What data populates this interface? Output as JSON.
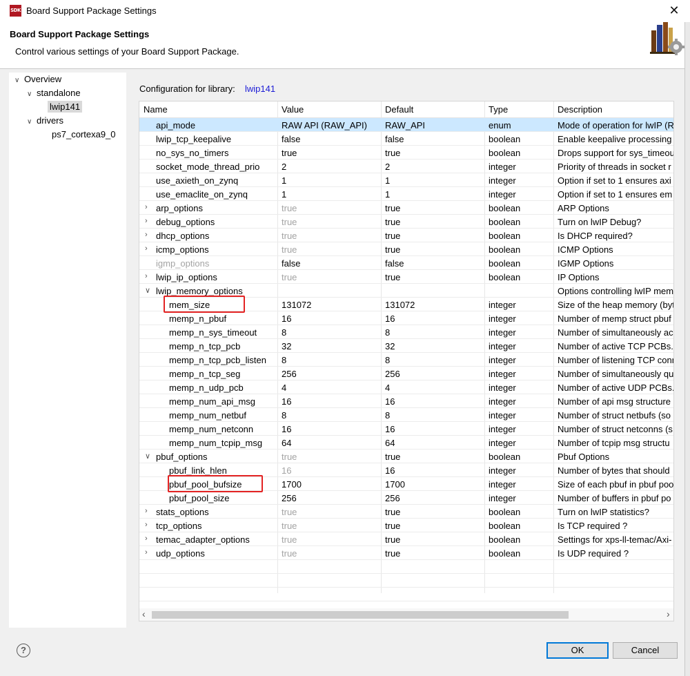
{
  "window": {
    "app_icon_text": "SDK",
    "title": "Board Support Package Settings",
    "close_glyph": "✕"
  },
  "header": {
    "title": "Board Support Package Settings",
    "subtitle": "Control various settings of your Board Support Package.",
    "banner_icon": "books-gear-icon"
  },
  "tree": [
    {
      "label": "Overview",
      "depth": 0,
      "expanded": true,
      "selected": false
    },
    {
      "label": "standalone",
      "depth": 1,
      "expanded": true,
      "selected": false
    },
    {
      "label": "lwip141",
      "depth": 2,
      "expanded": false,
      "selected": true
    },
    {
      "label": "drivers",
      "depth": 1,
      "expanded": true,
      "selected": false
    },
    {
      "label": "ps7_cortexa9_0",
      "depth": 2,
      "expanded": false,
      "selected": false
    }
  ],
  "config": {
    "label": "Configuration for library:",
    "library": "lwip141"
  },
  "table": {
    "columns": [
      "Name",
      "Value",
      "Default",
      "Type",
      "Description"
    ],
    "rows": [
      {
        "indent": 0,
        "expander": "",
        "name": "api_mode",
        "value": "RAW API (RAW_API)",
        "default": "RAW_API",
        "type": "enum",
        "description": "Mode of operation for lwIP (R",
        "selected": true
      },
      {
        "indent": 0,
        "expander": "",
        "name": "lwip_tcp_keepalive",
        "value": "false",
        "default": "false",
        "type": "boolean",
        "description": "Enable keepalive processing"
      },
      {
        "indent": 0,
        "expander": "",
        "name": "no_sys_no_timers",
        "value": "true",
        "default": "true",
        "type": "boolean",
        "description": "Drops support for sys_timeou"
      },
      {
        "indent": 0,
        "expander": "",
        "name": "socket_mode_thread_prio",
        "value": "2",
        "default": "2",
        "type": "integer",
        "description": "Priority of threads in socket r"
      },
      {
        "indent": 0,
        "expander": "",
        "name": "use_axieth_on_zynq",
        "value": "1",
        "default": "1",
        "type": "integer",
        "description": "Option if set to 1 ensures axi"
      },
      {
        "indent": 0,
        "expander": "",
        "name": "use_emaclite_on_zynq",
        "value": "1",
        "default": "1",
        "type": "integer",
        "description": "Option if set to 1 ensures em"
      },
      {
        "indent": 0,
        "expander": ">",
        "name": "arp_options",
        "value": "true",
        "value_dim": true,
        "default": "true",
        "type": "boolean",
        "description": "ARP Options"
      },
      {
        "indent": 0,
        "expander": ">",
        "name": "debug_options",
        "value": "true",
        "value_dim": true,
        "default": "true",
        "type": "boolean",
        "description": "Turn on lwIP Debug?"
      },
      {
        "indent": 0,
        "expander": ">",
        "name": "dhcp_options",
        "value": "true",
        "value_dim": true,
        "default": "true",
        "type": "boolean",
        "description": "Is DHCP required?"
      },
      {
        "indent": 0,
        "expander": ">",
        "name": "icmp_options",
        "value": "true",
        "value_dim": true,
        "default": "true",
        "type": "boolean",
        "description": "ICMP Options"
      },
      {
        "indent": 0,
        "expander": "",
        "name": "igmp_options",
        "name_dim": true,
        "value": "false",
        "default": "false",
        "type": "boolean",
        "description": "IGMP Options"
      },
      {
        "indent": 0,
        "expander": ">",
        "name": "lwip_ip_options",
        "value": "true",
        "value_dim": true,
        "default": "true",
        "type": "boolean",
        "description": "IP Options"
      },
      {
        "indent": 0,
        "expander": "v",
        "name": "lwip_memory_options",
        "value": "",
        "default": "",
        "type": "",
        "description": "Options controlling lwIP mem"
      },
      {
        "indent": 1,
        "expander": "",
        "name": "mem_size",
        "value": "131072",
        "default": "131072",
        "type": "integer",
        "description": "Size of the heap memory (byt"
      },
      {
        "indent": 1,
        "expander": "",
        "name": "memp_n_pbuf",
        "value": "16",
        "default": "16",
        "type": "integer",
        "description": "Number of memp struct pbuf"
      },
      {
        "indent": 1,
        "expander": "",
        "name": "memp_n_sys_timeout",
        "value": "8",
        "default": "8",
        "type": "integer",
        "description": "Number of simultaneously ac"
      },
      {
        "indent": 1,
        "expander": "",
        "name": "memp_n_tcp_pcb",
        "value": "32",
        "default": "32",
        "type": "integer",
        "description": "Number of active TCP PCBs. ("
      },
      {
        "indent": 1,
        "expander": "",
        "name": "memp_n_tcp_pcb_listen",
        "value": "8",
        "default": "8",
        "type": "integer",
        "description": "Number of listening TCP conn"
      },
      {
        "indent": 1,
        "expander": "",
        "name": "memp_n_tcp_seg",
        "value": "256",
        "default": "256",
        "type": "integer",
        "description": "Number of simultaneously qu"
      },
      {
        "indent": 1,
        "expander": "",
        "name": "memp_n_udp_pcb",
        "value": "4",
        "default": "4",
        "type": "integer",
        "description": "Number of active UDP PCBs."
      },
      {
        "indent": 1,
        "expander": "",
        "name": "memp_num_api_msg",
        "value": "16",
        "default": "16",
        "type": "integer",
        "description": "Number of api msg structure"
      },
      {
        "indent": 1,
        "expander": "",
        "name": "memp_num_netbuf",
        "value": "8",
        "default": "8",
        "type": "integer",
        "description": "Number of struct netbufs (so"
      },
      {
        "indent": 1,
        "expander": "",
        "name": "memp_num_netconn",
        "value": "16",
        "default": "16",
        "type": "integer",
        "description": "Number of struct netconns (s"
      },
      {
        "indent": 1,
        "expander": "",
        "name": "memp_num_tcpip_msg",
        "value": "64",
        "default": "64",
        "type": "integer",
        "description": "Number of tcpip msg structu"
      },
      {
        "indent": 0,
        "expander": "v",
        "name": "pbuf_options",
        "value": "true",
        "value_dim": true,
        "default": "true",
        "type": "boolean",
        "description": "Pbuf Options"
      },
      {
        "indent": 1,
        "expander": "",
        "name": "pbuf_link_hlen",
        "value": "16",
        "value_dim": true,
        "default": "16",
        "type": "integer",
        "description": "Number of bytes that should"
      },
      {
        "indent": 1,
        "expander": "",
        "name": "pbuf_pool_bufsize",
        "value": "1700",
        "default": "1700",
        "type": "integer",
        "description": "Size of each pbuf in pbuf poo"
      },
      {
        "indent": 1,
        "expander": "",
        "name": "pbuf_pool_size",
        "value": "256",
        "default": "256",
        "type": "integer",
        "description": "Number of buffers in pbuf po"
      },
      {
        "indent": 0,
        "expander": ">",
        "name": "stats_options",
        "value": "true",
        "value_dim": true,
        "default": "true",
        "type": "boolean",
        "description": "Turn on lwIP statistics?"
      },
      {
        "indent": 0,
        "expander": ">",
        "name": "tcp_options",
        "value": "true",
        "value_dim": true,
        "default": "true",
        "type": "boolean",
        "description": "Is TCP required ?"
      },
      {
        "indent": 0,
        "expander": ">",
        "name": "temac_adapter_options",
        "value": "true",
        "value_dim": true,
        "default": "true",
        "type": "boolean",
        "description": "Settings for xps-ll-temac/Axi-"
      },
      {
        "indent": 0,
        "expander": ">",
        "name": "udp_options",
        "value": "true",
        "value_dim": true,
        "default": "true",
        "type": "boolean",
        "description": "Is UDP required ?"
      }
    ],
    "highlighted_rows": [
      "mem_size",
      "pbuf_pool_bufsize"
    ]
  },
  "footer": {
    "help_glyph": "?",
    "ok_label": "OK",
    "cancel_label": "Cancel"
  },
  "colors": {
    "selected_row": "#cce8ff",
    "link": "#1a1ad6",
    "highlight_box": "#e32222",
    "dim_text": "#a3a3a3",
    "default_button_border": "#0078d7"
  }
}
